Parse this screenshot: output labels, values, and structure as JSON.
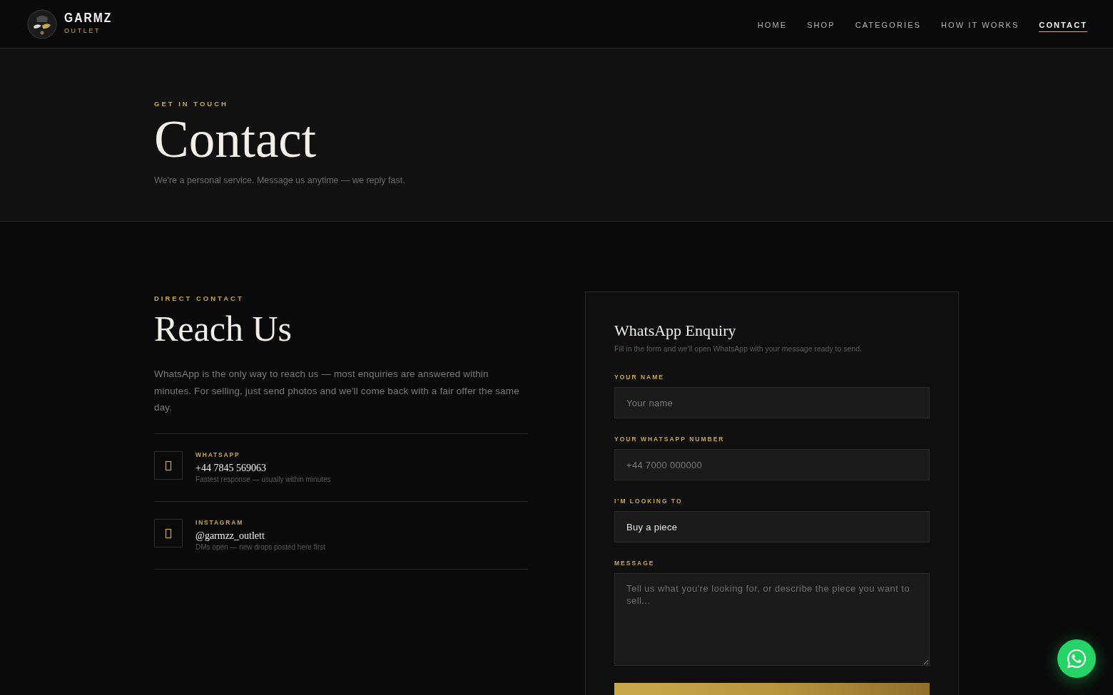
{
  "brand": {
    "name": "GARMZ",
    "tagline": "OUTLET"
  },
  "nav": [
    {
      "label": "HOME",
      "selected": false
    },
    {
      "label": "SHOP",
      "selected": false
    },
    {
      "label": "CATEGORIES",
      "selected": false
    },
    {
      "label": "HOW IT WORKS",
      "selected": false
    },
    {
      "label": "CONTACT",
      "selected": true
    }
  ],
  "hero": {
    "eyebrow": "GET IN TOUCH",
    "title": "Contact",
    "subtitle": "We're a personal service. Message us anytime — we reply fast."
  },
  "reach": {
    "eyebrow": "DIRECT CONTACT",
    "title": "Reach Us",
    "text": "WhatsApp is the only way to reach us — most enquiries are answered within minutes. For selling, just send photos and we'll come back with a fair offer the same day.",
    "channels": [
      {
        "label": "WHATSAPP",
        "value": "+44 7845 569063",
        "note": "Fastest response — usually within minutes"
      },
      {
        "label": "INSTAGRAM",
        "value": "@garmzz_outlett",
        "note": "DMs open — new drops posted here first"
      }
    ]
  },
  "form": {
    "title": "WhatsApp Enquiry",
    "subtitle": "Fill in the form and we'll open WhatsApp with your message ready to send.",
    "fields": [
      {
        "kind": "text",
        "label": "YOUR NAME",
        "placeholder": "Your name"
      },
      {
        "kind": "text",
        "label": "YOUR WHATSAPP NUMBER",
        "placeholder": "+44 7000 000000"
      },
      {
        "kind": "select",
        "label": "I'M LOOKING TO",
        "value": "Buy a piece"
      },
      {
        "kind": "textarea",
        "label": "MESSAGE",
        "placeholder": "Tell us what you're looking for, or describe the piece you want to sell..."
      }
    ]
  }
}
